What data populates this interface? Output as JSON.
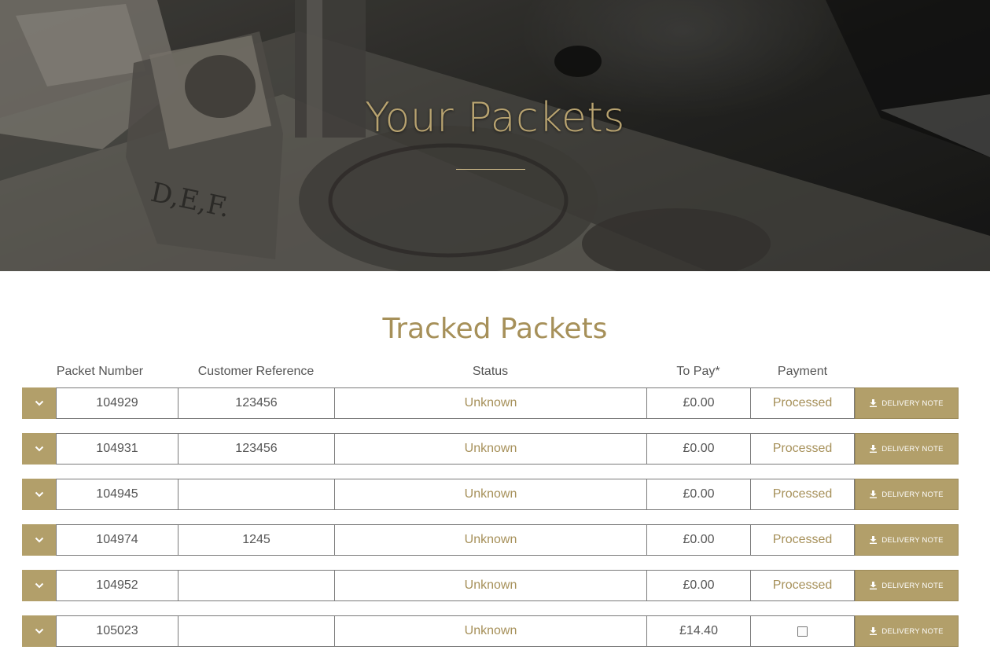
{
  "hero": {
    "title": "Your Packets"
  },
  "section": {
    "title": "Tracked Packets"
  },
  "columns": {
    "packet_number": "Packet Number",
    "customer_reference": "Customer Reference",
    "status": "Status",
    "to_pay": "To Pay*",
    "payment": "Payment"
  },
  "rows": [
    {
      "packet": "104929",
      "reference": "123456",
      "status": "Unknown",
      "to_pay": "£0.00",
      "payment": "Processed",
      "button": "DELIVERY NOTE"
    },
    {
      "packet": "104931",
      "reference": "123456",
      "status": "Unknown",
      "to_pay": "£0.00",
      "payment": "Processed",
      "button": "DELIVERY NOTE"
    },
    {
      "packet": "104945",
      "reference": "",
      "status": "Unknown",
      "to_pay": "£0.00",
      "payment": "Processed",
      "button": "DELIVERY NOTE"
    },
    {
      "packet": "104974",
      "reference": "1245",
      "status": "Unknown",
      "to_pay": "£0.00",
      "payment": "Processed",
      "button": "DELIVERY NOTE"
    },
    {
      "packet": "104952",
      "reference": "",
      "status": "Unknown",
      "to_pay": "£0.00",
      "payment": "Processed",
      "button": "DELIVERY NOTE"
    },
    {
      "packet": "105023",
      "reference": "",
      "status": "Unknown",
      "to_pay": "£14.40",
      "payment": "",
      "payment_checkbox": true,
      "button": "DELIVERY NOTE"
    }
  ],
  "colors": {
    "accent": "#b29f6a",
    "accent_text": "#a69059",
    "hero_title": "#b8a370",
    "body_text": "#555555"
  },
  "icons": {
    "toggle": "chevron-down-icon",
    "delivery_note": "download-icon"
  }
}
